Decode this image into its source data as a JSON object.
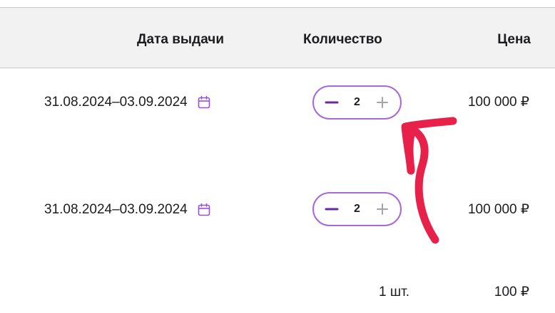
{
  "header": {
    "date_label": "Дата выдачи",
    "quantity_label": "Количество",
    "price_label": "Цена"
  },
  "rows": [
    {
      "date_range": "31.08.2024–03.09.2024",
      "quantity": "2",
      "price": "100 000 ₽"
    },
    {
      "date_range": "31.08.2024–03.09.2024",
      "quantity": "2",
      "price": "100 000 ₽"
    }
  ],
  "summary": {
    "quantity": "1 шт.",
    "price": "100 ₽"
  },
  "colors": {
    "accent": "#a868d8",
    "icon_purple": "#9b4fd6",
    "minus_dark": "#6a2a9a",
    "plus_gray": "#a3a3a8",
    "annotation_arrow": "#e8214a",
    "header_bg": "#f2f2f3"
  },
  "icons": {
    "calendar": "calendar-icon",
    "minus": "minus-icon",
    "plus": "plus-icon"
  }
}
